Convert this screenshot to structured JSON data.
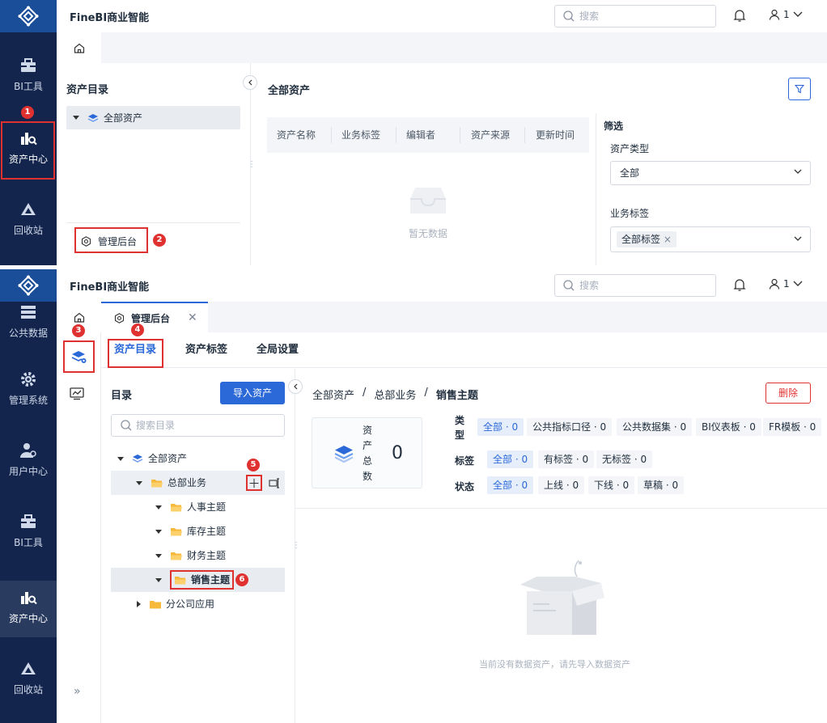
{
  "app": {
    "brand": "FineBI商业智能",
    "search_placeholder": "搜索",
    "user": "1"
  },
  "panel1": {
    "sidebar": [
      {
        "label": "BI工具"
      },
      {
        "label": "资产中心"
      },
      {
        "label": "回收站"
      }
    ],
    "left": {
      "title": "资产目录",
      "tree_root": "全部资产",
      "admin": "管理后台"
    },
    "main": {
      "title": "全部资产",
      "columns": [
        "资产名称",
        "业务标签",
        "编辑者",
        "资产来源",
        "更新时间"
      ],
      "empty": "暂无数据"
    },
    "filter": {
      "title": "筛选",
      "type_label": "资产类型",
      "type_value": "全部",
      "tag_label": "业务标签",
      "tag_chip": "全部标签"
    }
  },
  "panel2": {
    "sidebar": [
      {
        "label": "公共数据"
      },
      {
        "label": "管理系统"
      },
      {
        "label": "用户中心"
      },
      {
        "label": "BI工具"
      },
      {
        "label": "资产中心"
      },
      {
        "label": "回收站"
      }
    ],
    "tab_title": "管理后台",
    "subtabs": [
      "资产目录",
      "资产标签",
      "全局设置"
    ],
    "catalog": {
      "title": "目录",
      "import_button": "导入资产",
      "search_placeholder": "搜索目录",
      "tree": [
        "全部资产",
        "总部业务",
        "人事主题",
        "库存主题",
        "财务主题",
        "销售主题",
        "分公司应用"
      ]
    },
    "breadcrumb": [
      "全部资产",
      "总部业务",
      "销售主题"
    ],
    "delete_button": "删除",
    "stat": {
      "label": "资产总数",
      "value": "0"
    },
    "filters": {
      "type_label": "类型",
      "type": [
        "全部 · 0",
        "公共指标口径 · 0",
        "公共数据集 · 0",
        "BI仪表板 · 0",
        "FR模板 · 0"
      ],
      "tag_label": "标签",
      "tag": [
        "全部 · 0",
        "有标签 · 0",
        "无标签 · 0"
      ],
      "status_label": "状态",
      "status": [
        "全部 · 0",
        "上线 · 0",
        "下线 · 0",
        "草稿 · 0"
      ]
    },
    "empty": "当前没有数据资产，请先导入数据资产"
  },
  "badges": [
    "1",
    "2",
    "3",
    "4",
    "5",
    "6"
  ],
  "colors": {
    "sidebar": "#13254d",
    "logo": "#1b4e99",
    "accent": "#2b68d8",
    "danger": "#e03131"
  }
}
